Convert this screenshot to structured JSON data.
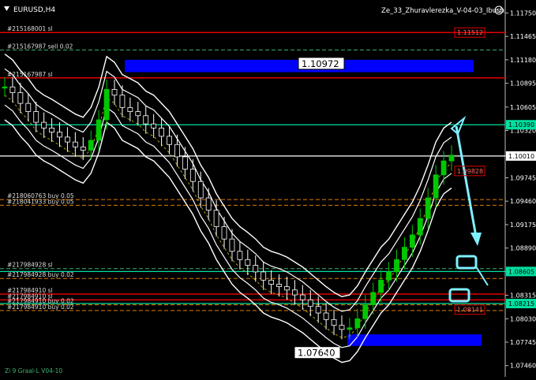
{
  "window": {
    "symbol_title": "EURUSD,H4",
    "indicator_title": "Ze_33_Zhuravlerezka_V-04-03_Ibush",
    "footer_label": "Zi 9 Graal-L V04-10",
    "smiley_icon": "smiley-icon"
  },
  "colors": {
    "background": "#000000",
    "candle_bull": "#00c800",
    "candle_bear": "#ffffff",
    "sl_line": "#e00000",
    "buy_line": "#e08000",
    "sell_line": "#3cb371",
    "tp_line": "#00e0a0",
    "blue_zone": "#0000ff",
    "arrow": "#7ff0ff"
  },
  "chart_data": {
    "type": "candlestick",
    "symbol": "EURUSD",
    "timeframe": "H4",
    "ylim": [
      1.074,
      1.1185
    ],
    "price_ticks": [
      "1.11750",
      "1.11465",
      "1.11180",
      "1.10895",
      "1.10605",
      "1.10320",
      "1.10010",
      "1.09745",
      "1.09460",
      "1.09175",
      "1.08890",
      "1.08605",
      "1.08315",
      "1.08030",
      "1.07745",
      "1.07460"
    ],
    "highlighted_prices": [
      {
        "text": "1.10390",
        "value": 1.1039,
        "color": "#00e0a0"
      },
      {
        "text": "1.10010",
        "value": 1.1001,
        "color": "#ffffff"
      },
      {
        "text": "1.08605",
        "value": 1.08605,
        "color": "#00e0a0"
      },
      {
        "text": "1.08215",
        "value": 1.08215,
        "color": "#00e0a0"
      }
    ],
    "tag_boxes": [
      {
        "text": "1.11512",
        "value": 1.11512
      },
      {
        "text": "1.09828",
        "value": 1.09828
      },
      {
        "text": "1.08141",
        "value": 1.08141
      }
    ],
    "order_levels": [
      {
        "label": "#215168001 sl",
        "value": 1.11512,
        "kind": "sl"
      },
      {
        "label": "#215167987 sell 0.02",
        "value": 1.113,
        "kind": "sell"
      },
      {
        "label": "#215167987 sl",
        "value": 1.1096,
        "kind": "sl"
      },
      {
        "label": "#218060763 buy 0.05",
        "value": 1.0948,
        "kind": "buy"
      },
      {
        "label": "#218041933 buy 0.05",
        "value": 1.0941,
        "kind": "buy"
      },
      {
        "label": "#217984928 sl",
        "value": 1.0864,
        "kind": "sell"
      },
      {
        "label": "#217984928 buy 0.02",
        "value": 1.0852,
        "kind": "buy"
      },
      {
        "label": "#217984910 sl",
        "value": 1.0833,
        "kind": "sl"
      },
      {
        "label": "#217984910 sl",
        "value": 1.0826,
        "kind": "sl"
      },
      {
        "label": "#217984910 buy 0.02",
        "value": 1.082,
        "kind": "buy"
      },
      {
        "label": "#217984910 buy 0.02",
        "value": 1.0813,
        "kind": "buy"
      }
    ],
    "zones": [
      {
        "label": "1.10972",
        "top": 1.1118,
        "bottom": 1.1103
      },
      {
        "label": "1.07640",
        "top": 1.0784,
        "bottom": 1.077
      }
    ],
    "close_series": [
      1.1085,
      1.1078,
      1.1065,
      1.1055,
      1.1042,
      1.1035,
      1.103,
      1.1024,
      1.1018,
      1.1012,
      1.1008,
      1.102,
      1.1045,
      1.1082,
      1.1075,
      1.106,
      1.1055,
      1.105,
      1.104,
      1.1035,
      1.1025,
      1.1015,
      1.1,
      1.0985,
      1.097,
      1.095,
      1.0935,
      1.0915,
      1.09,
      1.0885,
      1.0875,
      1.0868,
      1.086,
      1.085,
      1.0845,
      1.0842,
      1.0838,
      1.0832,
      1.0826,
      1.0818,
      1.081,
      1.0802,
      1.0795,
      1.079,
      1.0792,
      1.0803,
      1.082,
      1.0835,
      1.085,
      1.086,
      1.0875,
      1.089,
      1.0905,
      1.0925,
      1.095,
      1.0978,
      1.0995,
      1.1002
    ]
  }
}
